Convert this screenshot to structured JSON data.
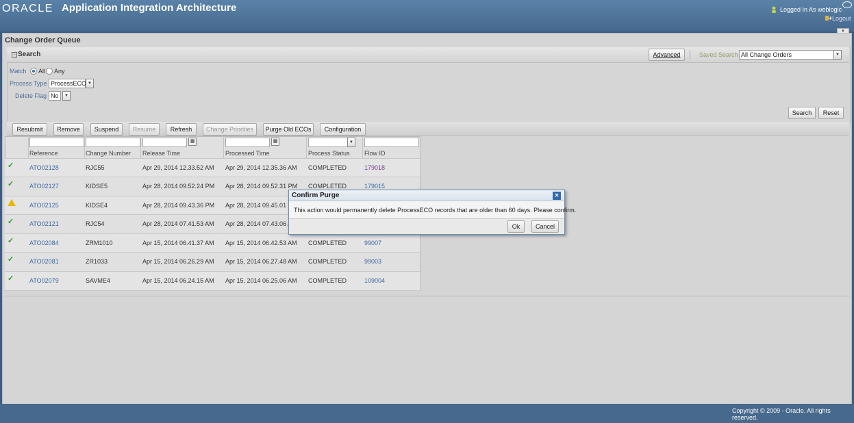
{
  "header": {
    "logo": "ORACLE",
    "app_title": "Application Integration Architecture",
    "logged_in": "Logged In As  weblogic",
    "logout": "Logout"
  },
  "page_title": "Change Order Queue",
  "search": {
    "title": "Search",
    "advanced": "Advanced",
    "saved_search_label": "Saved Search",
    "saved_search_value": "All Change Orders",
    "match_label": "Match",
    "match_all": "All",
    "match_any": "Any",
    "process_type_label": "Process Type",
    "process_type_value": "ProcessECO",
    "delete_flag_label": "Delete Flag",
    "delete_flag_value": "No",
    "search_button": "Search",
    "reset_button": "Reset"
  },
  "toolbar": {
    "resubmit": "Resubmit",
    "remove": "Remove",
    "suspend": "Suspend",
    "resume": "Resume",
    "refresh": "Refresh",
    "change_priorities": "Change Priorities",
    "purge": "Purge Old ECOs",
    "configuration": "Configuration"
  },
  "table": {
    "columns": [
      "Reference",
      "Change Number",
      "Release Time",
      "Processed Time",
      "Process Status",
      "Flow ID"
    ],
    "rows": [
      {
        "status_icon": "check-icon",
        "reference": "ATO02128",
        "change_number": "RJC55",
        "release_time": "Apr 29, 2014 12.33.52 AM",
        "processed_time": "Apr 29, 2014 12.35.36 AM",
        "process_status": "COMPLETED",
        "flow_id": "179018"
      },
      {
        "status_icon": "check-icon",
        "reference": "ATO02127",
        "change_number": "KIDSE5",
        "release_time": "Apr 28, 2014 09.52.24 PM",
        "processed_time": "Apr 28, 2014 09.52.31 PM",
        "process_status": "COMPLETED",
        "flow_id": "179015"
      },
      {
        "status_icon": "warning-icon",
        "reference": "ATO02125",
        "change_number": "KIDSE4",
        "release_time": "Apr 28, 2014 09.43.36 PM",
        "processed_time": "Apr 28, 2014 09.45.01 P",
        "process_status": "",
        "flow_id": ""
      },
      {
        "status_icon": "check-icon",
        "reference": "ATO02121",
        "change_number": "RJC54",
        "release_time": "Apr 28, 2014 07.41.53 AM",
        "processed_time": "Apr 28, 2014 07.43.06 A",
        "process_status": "",
        "flow_id": ""
      },
      {
        "status_icon": "check-icon",
        "reference": "ATO02084",
        "change_number": "ZRM1010",
        "release_time": "Apr 15, 2014 06.41.37 AM",
        "processed_time": "Apr 15, 2014 06.42.53 AM",
        "process_status": "COMPLETED",
        "flow_id": "99007"
      },
      {
        "status_icon": "check-icon",
        "reference": "ATO02081",
        "change_number": "ZR1033",
        "release_time": "Apr 15, 2014 06.26.29 AM",
        "processed_time": "Apr 15, 2014 06.27.48 AM",
        "process_status": "COMPLETED",
        "flow_id": "99003"
      },
      {
        "status_icon": "check-icon",
        "reference": "ATO02079",
        "change_number": "SAVME4",
        "release_time": "Apr 15, 2014 06.24.15 AM",
        "processed_time": "Apr 15, 2014 06.25.06 AM",
        "process_status": "COMPLETED",
        "flow_id": "109004"
      }
    ]
  },
  "dialog": {
    "title": "Confirm Purge",
    "message": "This action would permanently delete ProcessECO records that are older than 60 days. Please confirm.",
    "ok": "Ok",
    "cancel": "Cancel"
  },
  "footer": {
    "copyright": "Copyright © 2009 - Oracle. All rights reserved."
  }
}
